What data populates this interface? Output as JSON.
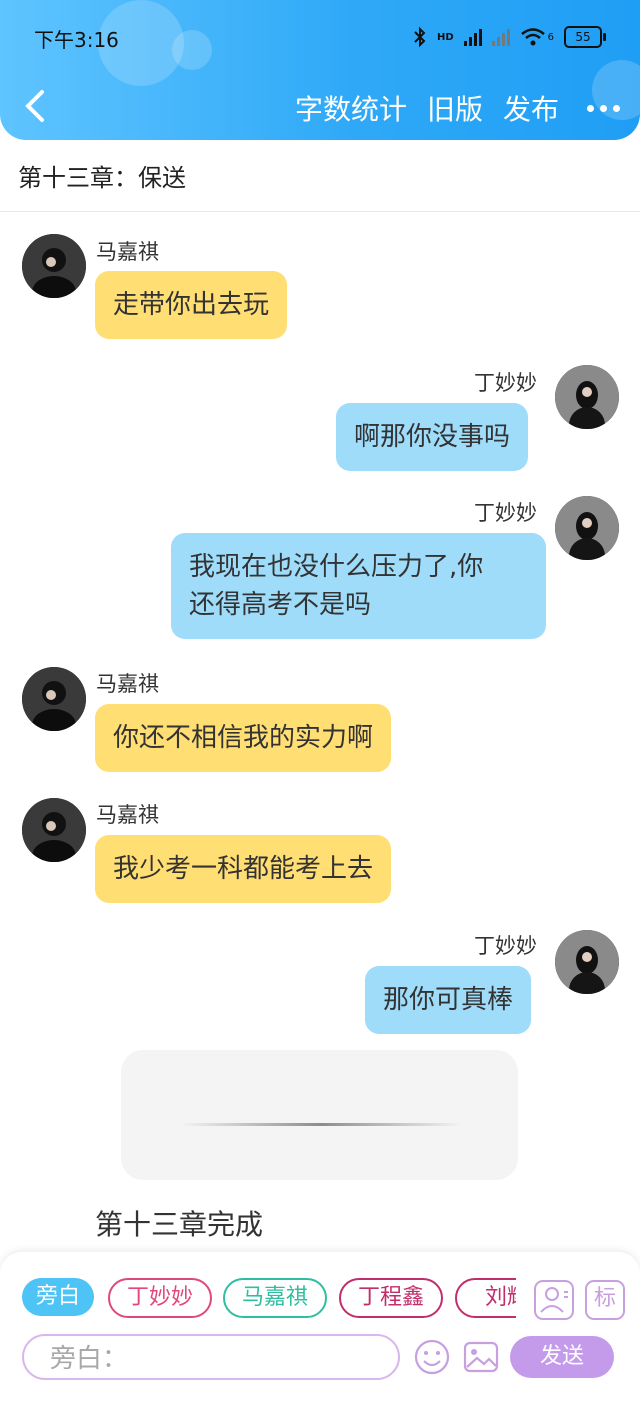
{
  "status_bar": {
    "time": "下午3:16",
    "hd_label": "HD",
    "wifi_label": "6",
    "battery": "55"
  },
  "nav": {
    "word_count": "字数统计",
    "old_version": "旧版",
    "publish": "发布"
  },
  "chapter": {
    "title": "第十三章：保送",
    "done_label": "第十三章完成"
  },
  "messages": [
    {
      "speaker": "马嘉祺",
      "text": "走带你出去玩",
      "side": "left"
    },
    {
      "speaker": "丁妙妙",
      "text": "啊那你没事吗",
      "side": "right"
    },
    {
      "speaker": "丁妙妙",
      "text_line1": "我现在也没什么压力了,你",
      "text_line2": "还得高考不是吗",
      "side": "right"
    },
    {
      "speaker": "马嘉祺",
      "text": "你还不相信我的实力啊",
      "side": "left"
    },
    {
      "speaker": "马嘉祺",
      "text": "我少考一科都能考上去",
      "side": "left"
    },
    {
      "speaker": "丁妙妙",
      "text": "那你可真棒",
      "side": "right"
    }
  ],
  "composer": {
    "roles": [
      "旁白",
      "丁妙妙",
      "马嘉祺",
      "丁程鑫",
      "刘耀"
    ],
    "tag_label": "标",
    "input_placeholder": "旁白：",
    "send_label": "发送"
  },
  "colors": {
    "header": "#2fa9f7",
    "left_bubble": "#ffde73",
    "right_bubble": "#9fdcfa",
    "send": "#c49bea"
  }
}
